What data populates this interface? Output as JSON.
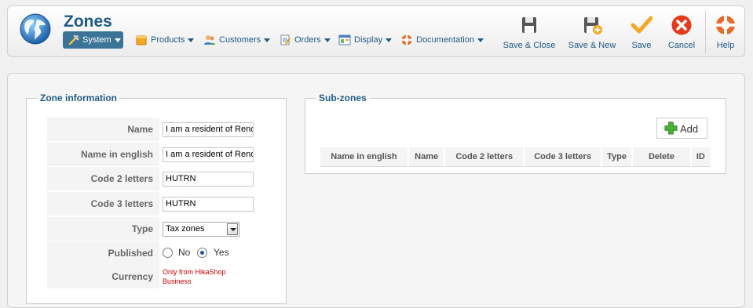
{
  "header": {
    "title": "Zones",
    "menu": [
      {
        "label": "System",
        "icon": "tools-icon",
        "active": true
      },
      {
        "label": "Products",
        "icon": "products-box-icon",
        "active": false
      },
      {
        "label": "Customers",
        "icon": "customers-icon",
        "active": false
      },
      {
        "label": "Orders",
        "icon": "orders-icon",
        "active": false
      },
      {
        "label": "Display",
        "icon": "display-icon",
        "active": false
      },
      {
        "label": "Documentation",
        "icon": "lifebuoy-icon",
        "active": false
      }
    ],
    "toolbar": {
      "save_close": "Save & Close",
      "save_new": "Save & New",
      "save": "Save",
      "cancel": "Cancel",
      "help": "Help"
    }
  },
  "zone_info": {
    "legend": "Zone information",
    "fields": {
      "name": {
        "label": "Name",
        "value": "I am a resident of Reno"
      },
      "name_english": {
        "label": "Name in english",
        "value": "I am a resident of Reno"
      },
      "code2": {
        "label": "Code 2 letters",
        "value": "HUTRN"
      },
      "code3": {
        "label": "Code 3 letters",
        "value": "HUTRN"
      },
      "type": {
        "label": "Type",
        "value": "Tax zones"
      },
      "published": {
        "label": "Published",
        "options": [
          "No",
          "Yes"
        ],
        "selected": "Yes"
      },
      "currency": {
        "label": "Currency",
        "note": "Only from HikaShop Business"
      }
    }
  },
  "subzones": {
    "legend": "Sub-zones",
    "add_label": "Add",
    "columns": [
      "Name in english",
      "Name",
      "Code 2 letters",
      "Code 3 letters",
      "Type",
      "Delete",
      "ID"
    ],
    "rows": []
  },
  "colors": {
    "accent": "#1e5a87",
    "active_menu": "#3c7498",
    "warning_text": "#cc0000"
  }
}
